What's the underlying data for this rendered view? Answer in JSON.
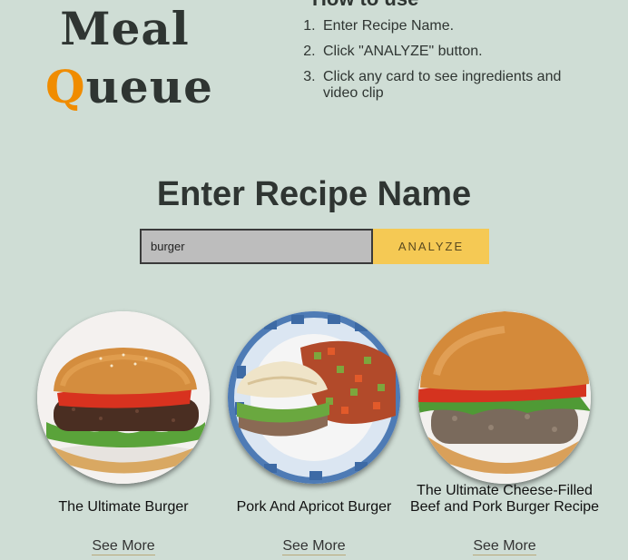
{
  "logo": {
    "line1": "Meal",
    "accent_letter": "Q",
    "line2_rest": "ueue"
  },
  "howto": {
    "title": "How to use",
    "steps": [
      "Enter Recipe Name.",
      "Click \"ANALYZE\" button.",
      "Click any card to see ingredients and video clip"
    ]
  },
  "search": {
    "title": "Enter Recipe Name",
    "value": "burger",
    "button_label": "ANALYZE"
  },
  "cards": [
    {
      "title": "The Ultimate Burger",
      "see_more": "See More",
      "image": "burger-photo"
    },
    {
      "title": "Pork And Apricot Burger",
      "see_more": "See More",
      "image": "pork-burger-photo"
    },
    {
      "title": "The Ultimate Cheese-Filled Beef and Pork Burger Recipe",
      "see_more": "See More",
      "image": "cheese-burger-photo"
    }
  ],
  "colors": {
    "background": "#cfddd5",
    "accent": "#f08c00",
    "button": "#f5c954"
  }
}
